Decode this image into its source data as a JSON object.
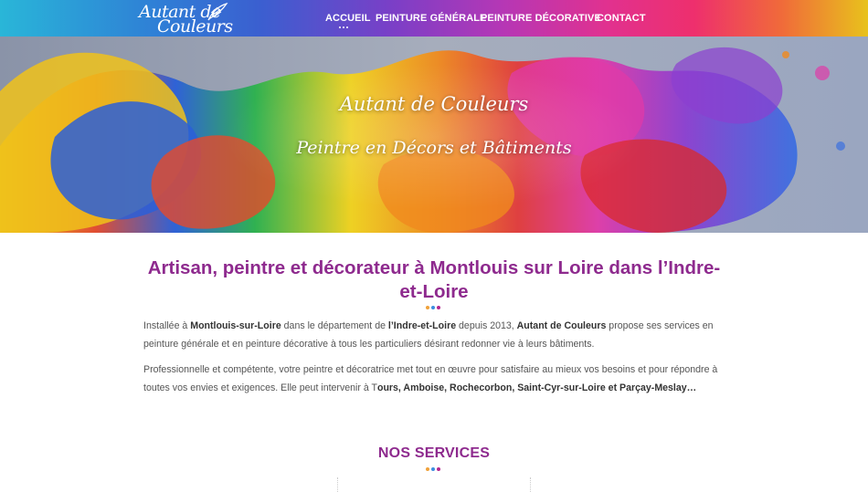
{
  "header": {
    "logo": {
      "line1": "Autant de",
      "line2": "Couleurs",
      "icon": "feather-icon"
    },
    "nav": [
      {
        "label": "ACCUEIL",
        "active": true
      },
      {
        "label": "PEINTURE GÉNÉRALE",
        "active": false
      },
      {
        "label": "PEINTURE DÉCORATIVE",
        "active": false
      },
      {
        "label": "CONTACT",
        "active": false
      }
    ]
  },
  "hero": {
    "title": "Autant de Couleurs",
    "subtitle": "Peintre en Décors et Bâtiments"
  },
  "intro": {
    "heading": "Artisan, peintre et décorateur à Montlouis sur Loire dans l’Indre-et-Loire",
    "paragraph1": {
      "t1": "Installée à ",
      "b1": "Montlouis-sur-Loire",
      "t2": " dans le département de ",
      "b2": "l’Indre-et-Loire",
      "t3": " depuis 2013, ",
      "b3": "Autant de Couleurs",
      "t4": " propose ses services en peinture générale et en peinture décorative à tous les particuliers désirant redonner vie à leurs bâtiments."
    },
    "paragraph2": {
      "t1": "Professionnelle et compétente, votre peintre et décoratrice met tout en œuvre pour satisfaire au mieux vos besoins et pour répondre à toutes vos envies et exigences. Elle peut intervenir à T",
      "b1": "ours, Amboise, Rochecorbon, Saint-Cyr-sur-Loire et Parçay-Meslay…"
    }
  },
  "services": {
    "heading": "NOS SERVICES"
  },
  "colors": {
    "accent": "#8e2a8e",
    "dot1": "#f0a23b",
    "dot2": "#3d8ee0",
    "dot3": "#b3278f"
  }
}
